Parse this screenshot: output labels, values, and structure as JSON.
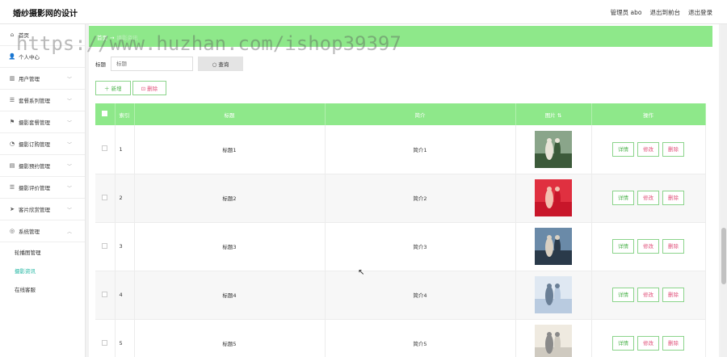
{
  "header": {
    "title": "婚纱摄影网的设计",
    "links": [
      "管理员 abo",
      "退出到前台",
      "退出登录"
    ]
  },
  "sidebar": {
    "items": [
      {
        "icon": "home-icon",
        "label": "首页",
        "has_chevron": false
      },
      {
        "icon": "user-icon",
        "label": "个人中心",
        "has_chevron": false
      },
      {
        "icon": "bar-chart-icon",
        "label": "用户管理",
        "has_chevron": true
      },
      {
        "icon": "list-icon",
        "label": "套餐系列管理",
        "has_chevron": true
      },
      {
        "icon": "flag-icon",
        "label": "摄影套餐管理",
        "has_chevron": true
      },
      {
        "icon": "clock-icon",
        "label": "摄影订购管理",
        "has_chevron": true
      },
      {
        "icon": "chart-icon",
        "label": "摄影预约管理",
        "has_chevron": true
      },
      {
        "icon": "list-icon",
        "label": "摄影评价管理",
        "has_chevron": true
      },
      {
        "icon": "send-icon",
        "label": "客片欣赏管理",
        "has_chevron": true
      },
      {
        "icon": "settings-icon",
        "label": "系统管理",
        "has_chevron": true
      }
    ],
    "sub_items": [
      {
        "label": "轮播图管理",
        "active": false
      },
      {
        "label": "摄影资讯",
        "active": true
      },
      {
        "label": "在线客服",
        "active": false
      }
    ]
  },
  "breadcrumb": {
    "home": "首页",
    "current": "摄影资讯"
  },
  "watermark": "https://www.huzhan.com/ishop39397",
  "search": {
    "label": "标题",
    "placeholder": "标题",
    "button": "查询"
  },
  "actions": {
    "add": "新增",
    "delete": "删除"
  },
  "table": {
    "headers": [
      "",
      "索引",
      "标题",
      "简介",
      "图片",
      "操作"
    ],
    "rows": [
      {
        "index": "1",
        "title": "标题1",
        "intro": "简介1",
        "photo_palette": [
          "#3c5a3a",
          "#8aa58a",
          "#e9e4d8"
        ]
      },
      {
        "index": "2",
        "title": "标题2",
        "intro": "简介2",
        "photo_palette": [
          "#c8162a",
          "#e03040",
          "#f3c0b0"
        ]
      },
      {
        "index": "3",
        "title": "标题3",
        "intro": "简介3",
        "photo_palette": [
          "#2a3a4a",
          "#6a8aa8",
          "#d9d0c2"
        ]
      },
      {
        "index": "4",
        "title": "标题4",
        "intro": "简介4",
        "photo_palette": [
          "#b9cbe0",
          "#dfe8f2",
          "#6a7f96"
        ]
      },
      {
        "index": "5",
        "title": "标题5",
        "intro": "简介5",
        "photo_palette": [
          "#cfcac0",
          "#efeae0",
          "#8a8a8a"
        ]
      }
    ],
    "ops": {
      "detail": "详情",
      "edit": "修改",
      "remove": "删除"
    }
  },
  "colors": {
    "accent": "#8ee88a",
    "link_active": "#23b7a3",
    "danger": "#e0507a"
  }
}
